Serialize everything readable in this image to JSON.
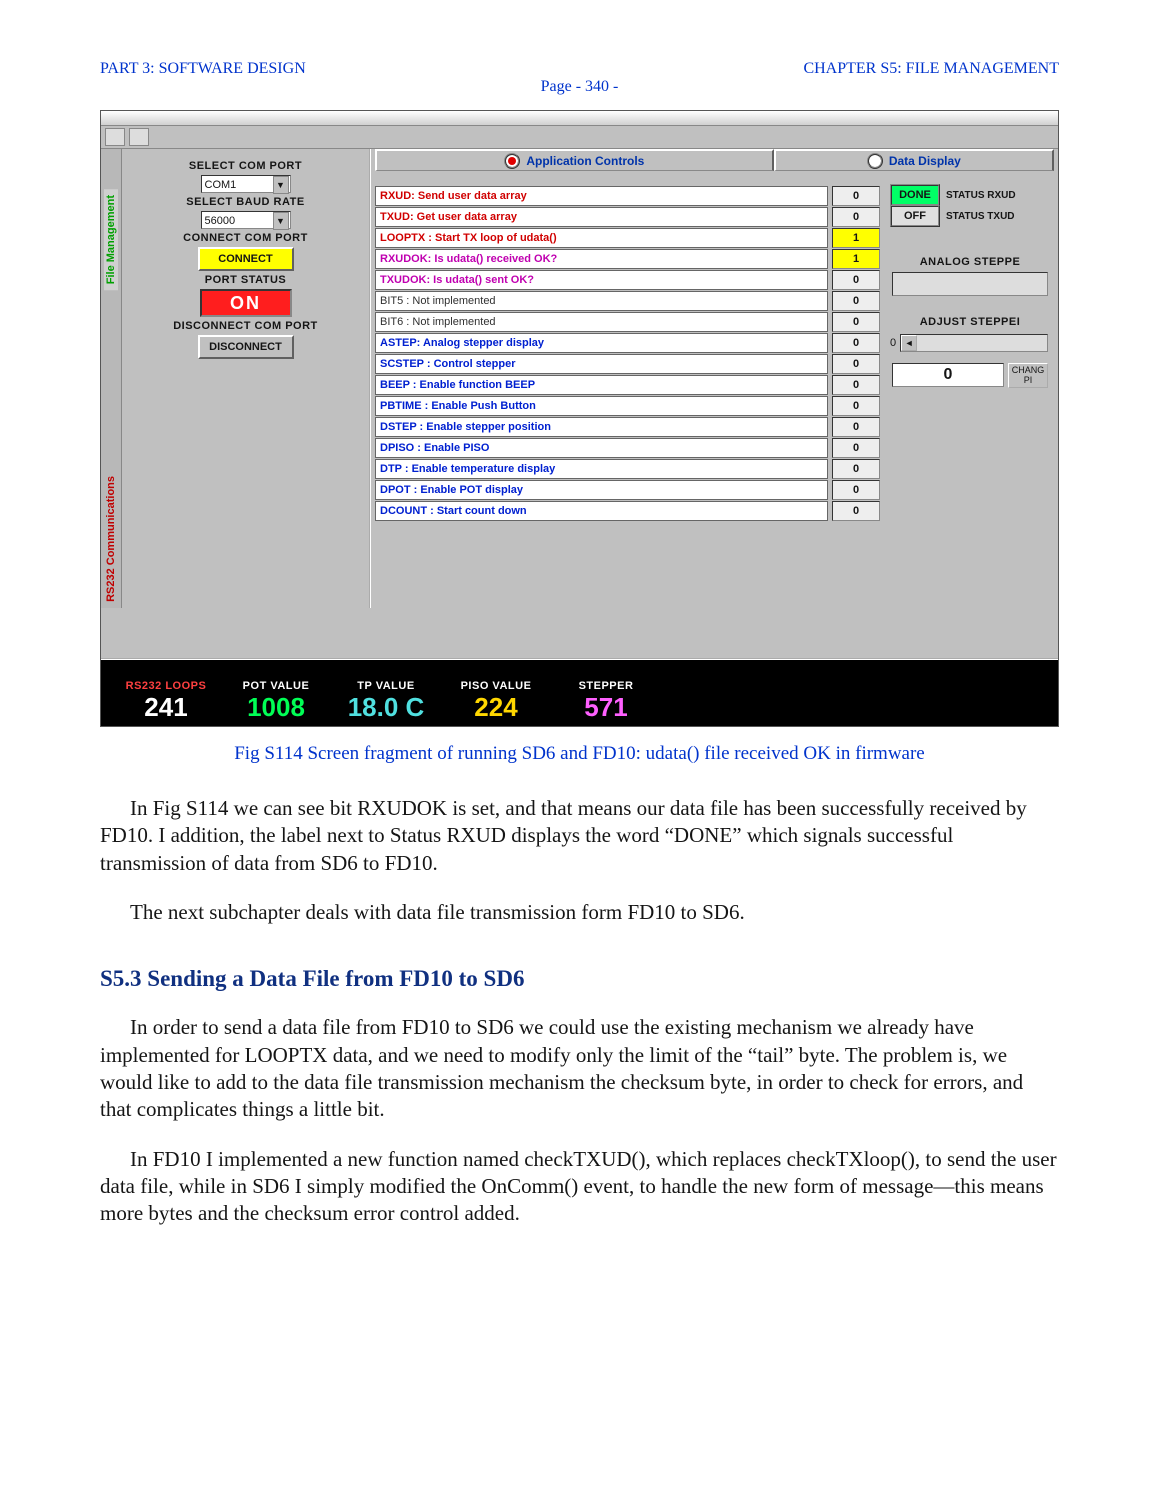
{
  "header": {
    "left": "PART 3: SOFTWARE DESIGN",
    "right": "CHAPTER S5: FILE MANAGEMENT",
    "page": "Page - 340 -"
  },
  "screenshot": {
    "vtabs": {
      "top": "File Management",
      "bottom": "RS232 Communications"
    },
    "left_pane": {
      "com_port_head": "SELECT COM PORT",
      "com_port_value": "COM1",
      "baud_head": "SELECT BAUD RATE",
      "baud_value": "56000",
      "connect_head": "CONNECT COM PORT",
      "connect_btn": "CONNECT",
      "port_status_head": "PORT STATUS",
      "port_status_value": "ON",
      "disconnect_head": "DISCONNECT COM PORT",
      "disconnect_btn": "DISCONNECT"
    },
    "tabs": {
      "app_controls": "Application Controls",
      "data_display": "Data Display"
    },
    "rows": [
      {
        "label": "RXUD: Send user data array",
        "cls": "bold red",
        "val": "0",
        "vcls": ""
      },
      {
        "label": "TXUD: Get user data array",
        "cls": "bold red",
        "val": "0",
        "vcls": ""
      },
      {
        "label": "LOOPTX : Start TX loop of udata()",
        "cls": "bold red",
        "val": "1",
        "vcls": "yellow"
      },
      {
        "label": "RXUDOK: Is udata() received OK?",
        "cls": "bold magenta",
        "val": "1",
        "vcls": "yellow"
      },
      {
        "label": "TXUDOK: Is udata() sent OK?",
        "cls": "bold magenta",
        "val": "0",
        "vcls": ""
      },
      {
        "label": "BIT5 : Not implemented",
        "cls": "plain",
        "val": "0",
        "vcls": ""
      },
      {
        "label": "BIT6 : Not implemented",
        "cls": "plain",
        "val": "0",
        "vcls": ""
      },
      {
        "label": "ASTEP: Analog stepper display",
        "cls": "bold blue",
        "val": "0",
        "vcls": ""
      },
      {
        "label": "SCSTEP : Control stepper",
        "cls": "bold blue",
        "val": "0",
        "vcls": ""
      },
      {
        "label": "BEEP : Enable function BEEP",
        "cls": "bold blue",
        "val": "0",
        "vcls": ""
      },
      {
        "label": "PBTIME : Enable Push Button",
        "cls": "bold blue",
        "val": "0",
        "vcls": ""
      },
      {
        "label": "DSTEP : Enable stepper position",
        "cls": "bold blue",
        "val": "0",
        "vcls": ""
      },
      {
        "label": "DPISO : Enable PISO",
        "cls": "bold blue",
        "val": "0",
        "vcls": ""
      },
      {
        "label": "DTP : Enable temperature display",
        "cls": "bold blue",
        "val": "0",
        "vcls": ""
      },
      {
        "label": "DPOT : Enable POT display",
        "cls": "bold blue",
        "val": "0",
        "vcls": ""
      },
      {
        "label": "DCOUNT : Start count down",
        "cls": "bold blue",
        "val": "0",
        "vcls": ""
      }
    ],
    "right_pane": {
      "status_rxud_label": "STATUS RXUD",
      "status_rxud_value": "DONE",
      "status_txud_label": "STATUS TXUD",
      "status_txud_value": "OFF",
      "analog_head": "ANALOG STEPPE",
      "adjust_head": "ADJUST STEPPEI",
      "adjust_zero": "0",
      "readout_value": "0",
      "change_btn": "CHANG\nPI"
    },
    "status_bar": {
      "cols": [
        {
          "head": "RS232 LOOPS",
          "val": "241",
          "cls": "white",
          "hcls": "red"
        },
        {
          "head": "POT VALUE",
          "val": "1008",
          "cls": "green",
          "hcls": ""
        },
        {
          "head": "TP VALUE",
          "val": "18.0 C",
          "cls": "cyan",
          "hcls": ""
        },
        {
          "head": "PISO VALUE",
          "val": "224",
          "cls": "yellow",
          "hcls": ""
        },
        {
          "head": "STEPPER",
          "val": "571",
          "cls": "mag",
          "hcls": ""
        }
      ]
    }
  },
  "caption": "Fig S114 Screen fragment of running SD6 and FD10: udata() file received OK in firmware",
  "para1": "In Fig S114 we can see bit RXUDOK is set, and that means our data file has been successfully received by FD10. I addition, the label next to Status RXUD displays the word “DONE” which signals successful transmission of data from SD6 to FD10.",
  "para2": "The next subchapter deals with data file transmission form FD10 to SD6.",
  "heading": "S5.3 Sending a Data File from FD10 to SD6",
  "para3": "In order to send a data file from FD10 to SD6 we could use the existing mechanism we already have implemented for LOOPTX data, and we need to modify only the limit of the “tail” byte. The problem is, we would like to add to the data file transmission mechanism the checksum byte, in order to check for errors, and that complicates things a little bit.",
  "para4": "In FD10 I implemented a new function named checkTXUD(), which replaces checkTXloop(), to send the user data file, while in SD6 I simply modified the OnComm() event, to handle the new form of message—this means more bytes and the checksum error control added."
}
